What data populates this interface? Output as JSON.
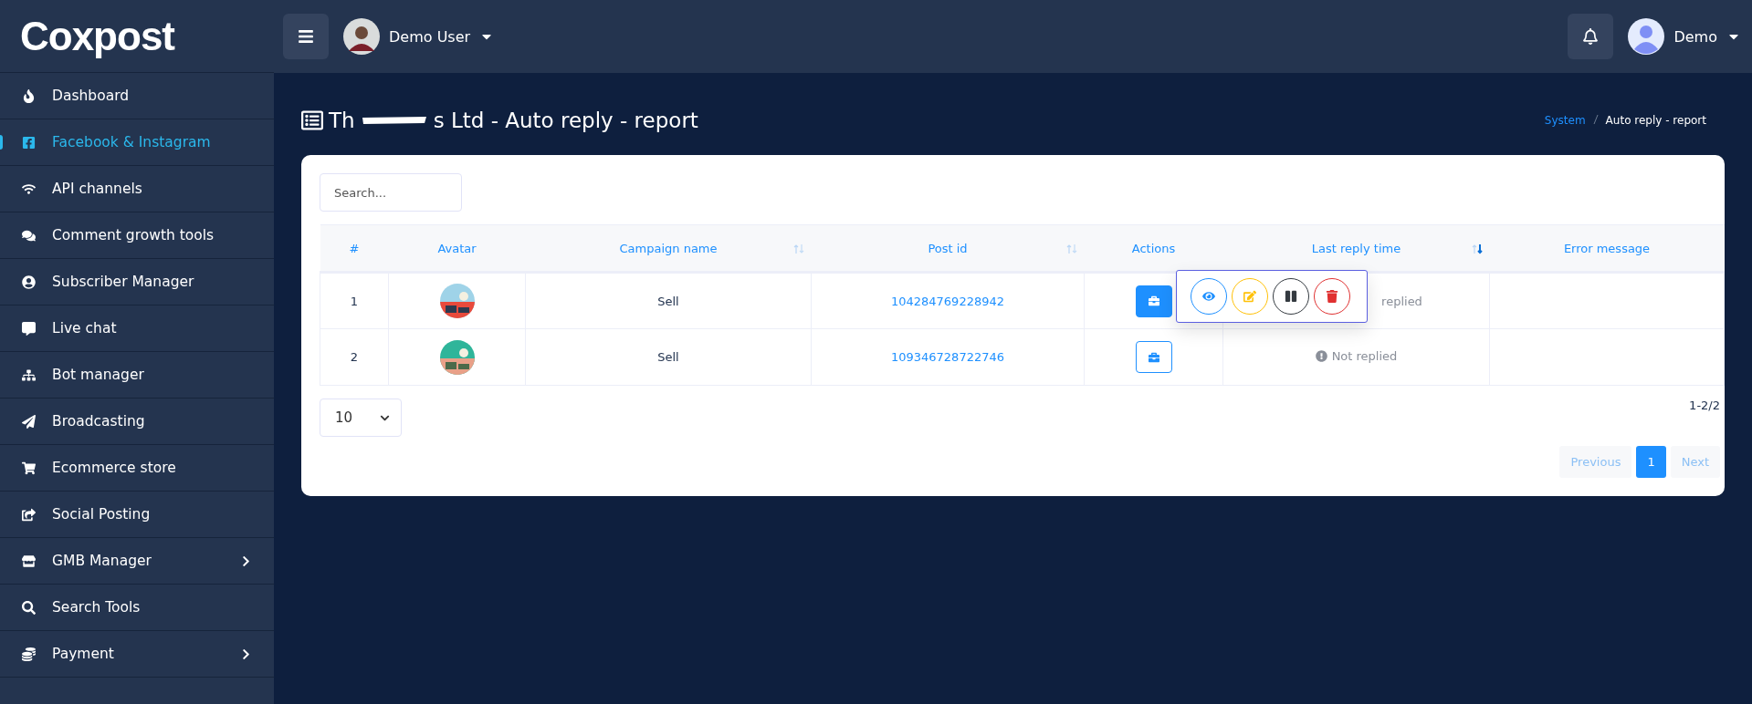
{
  "logo": "Coxpost",
  "topbar": {
    "user_name": "Demo User",
    "account_name": "Demo"
  },
  "sidebar": {
    "items": [
      {
        "label": "Dashboard",
        "selected": false,
        "has_submenu": false
      },
      {
        "label": "Facebook & Instagram",
        "selected": true,
        "has_submenu": false
      },
      {
        "label": "API channels",
        "selected": false,
        "has_submenu": false
      },
      {
        "label": "Comment growth tools",
        "selected": false,
        "has_submenu": false
      },
      {
        "label": "Subscriber Manager",
        "selected": false,
        "has_submenu": false
      },
      {
        "label": "Live chat",
        "selected": false,
        "has_submenu": false
      },
      {
        "label": "Bot manager",
        "selected": false,
        "has_submenu": false
      },
      {
        "label": "Broadcasting",
        "selected": false,
        "has_submenu": false
      },
      {
        "label": "Ecommerce store",
        "selected": false,
        "has_submenu": false
      },
      {
        "label": "Social Posting",
        "selected": false,
        "has_submenu": false
      },
      {
        "label": "GMB Manager",
        "selected": false,
        "has_submenu": true
      },
      {
        "label": "Search Tools",
        "selected": false,
        "has_submenu": false
      },
      {
        "label": "Payment",
        "selected": false,
        "has_submenu": true
      }
    ]
  },
  "page": {
    "title_start": "Th",
    "title_end": "s Ltd - Auto reply - report",
    "breadcrumb": [
      {
        "label": "System",
        "kind": "link"
      },
      {
        "label": "Auto reply - report",
        "kind": "current"
      }
    ]
  },
  "search": {
    "placeholder": "Search..."
  },
  "table": {
    "columns": [
      {
        "label": "#",
        "sortable": false,
        "sorted_desc": false
      },
      {
        "label": "Avatar",
        "sortable": false,
        "sorted_desc": false
      },
      {
        "label": "Campaign name",
        "sortable": true,
        "sorted_desc": false
      },
      {
        "label": "Post id",
        "sortable": true,
        "sorted_desc": false
      },
      {
        "label": "Actions",
        "sortable": false,
        "sorted_desc": false
      },
      {
        "label": "Last reply time",
        "sortable": true,
        "sorted_desc": true
      },
      {
        "label": "Error message",
        "sortable": false,
        "sorted_desc": false
      }
    ],
    "rows": [
      {
        "index": "1",
        "campaign": "Sell",
        "post_id": "104284769228942",
        "actions_expanded": true,
        "last_reply": "replied",
        "last_reply_icon": false
      },
      {
        "index": "2",
        "campaign": "Sell",
        "post_id": "109346728722746",
        "actions_expanded": false,
        "last_reply": "Not replied",
        "last_reply_icon": true
      }
    ]
  },
  "page_size": "10",
  "range": "1-2/2",
  "pagination": [
    {
      "label": "Previous",
      "selected": false
    },
    {
      "label": "1",
      "selected": true
    },
    {
      "label": "Next",
      "selected": false
    }
  ]
}
